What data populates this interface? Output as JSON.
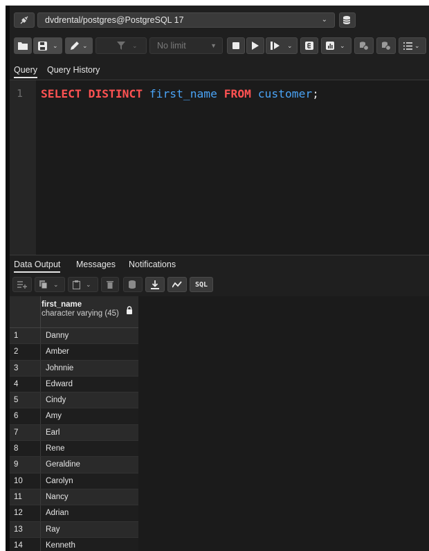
{
  "connection": {
    "label": "dvdrental/postgres@PostgreSQL 17"
  },
  "toolbar": {
    "limit_value": "No limit"
  },
  "query_tabs": [
    {
      "label": "Query"
    },
    {
      "label": "Query History"
    }
  ],
  "editor": {
    "line_number": "1",
    "tokens": {
      "select": "SELECT",
      "distinct": "DISTINCT",
      "column": "first_name",
      "from": "FROM",
      "table": "customer",
      "semicolon": ";"
    }
  },
  "output_tabs": [
    {
      "label": "Data Output"
    },
    {
      "label": "Messages"
    },
    {
      "label": "Notifications"
    }
  ],
  "output_toolbar": {
    "sql_label": "SQL"
  },
  "grid": {
    "column": {
      "name": "first_name",
      "type": "character varying (45)"
    },
    "rows": [
      {
        "n": "1",
        "value": "Danny"
      },
      {
        "n": "2",
        "value": "Amber"
      },
      {
        "n": "3",
        "value": "Johnnie"
      },
      {
        "n": "4",
        "value": "Edward"
      },
      {
        "n": "5",
        "value": "Cindy"
      },
      {
        "n": "6",
        "value": "Amy"
      },
      {
        "n": "7",
        "value": "Earl"
      },
      {
        "n": "8",
        "value": "Rene"
      },
      {
        "n": "9",
        "value": "Geraldine"
      },
      {
        "n": "10",
        "value": "Carolyn"
      },
      {
        "n": "11",
        "value": "Nancy"
      },
      {
        "n": "12",
        "value": "Adrian"
      },
      {
        "n": "13",
        "value": "Ray"
      },
      {
        "n": "14",
        "value": "Kenneth"
      }
    ]
  }
}
